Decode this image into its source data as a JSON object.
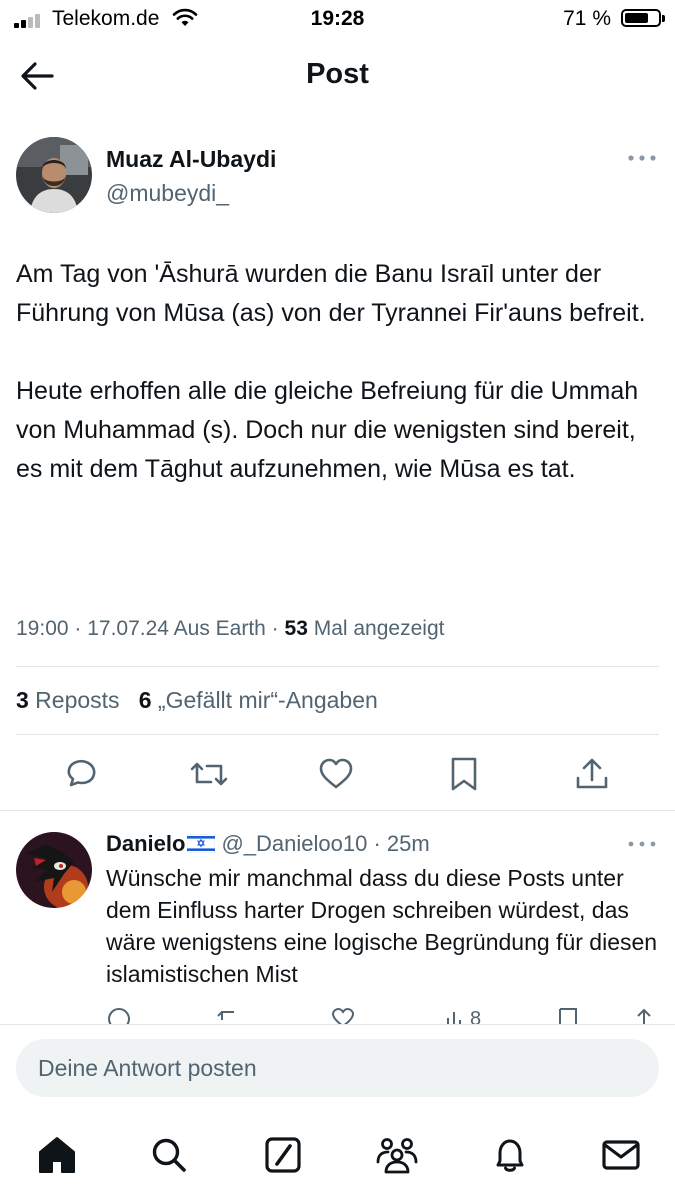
{
  "status_bar": {
    "carrier": "Telekom.de",
    "time": "19:28",
    "battery": "71 %",
    "battery_level": 0.71,
    "icons": [
      "signal-icon",
      "wifi-icon",
      "battery-icon"
    ]
  },
  "header": {
    "title": "Post",
    "back_icon": "back-arrow-icon"
  },
  "post": {
    "author_name": "Muaz Al-Ubaydi",
    "author_handle": "@mubeydi_",
    "paragraph1": "Am Tag von 'Āshurā wurden die Banu Israīl unter der Führung von Mūsa (as) von der Tyrannei Fir'auns befreit.",
    "paragraph2": "Heute erhoffen alle die gleiche Befreiung für die Ummah von Muhammad (s). Doch nur die wenigsten sind bereit, es mit dem Tāghut aufzunehmen, wie Mūsa es tat.",
    "meta_time": "19:00 · 17.07.24 Aus Earth · ",
    "views_count": "53",
    "views_label": " Mal angezeigt",
    "reposts_count": "3",
    "reposts_label": " Reposts",
    "likes_count": "6",
    "likes_label": " „Gefällt mir“-Angaben",
    "action_icons": [
      "reply-icon",
      "repost-icon",
      "like-icon",
      "bookmark-icon",
      "share-icon"
    ]
  },
  "reply": {
    "name": "Danielo",
    "handle": "@_Danieloo10",
    "time": "· 25m",
    "text": "Wünsche mir manchmal dass du diese Posts unter dem Einfluss harter Drogen schreiben würdest, das wäre wenigstens eine logische Begründung für diesen islamistischen Mist",
    "views": "8"
  },
  "compose": {
    "placeholder": "Deine Antwort posten"
  },
  "tab_bar": {
    "icons": [
      "home-icon",
      "search-icon",
      "compose-icon",
      "communities-icon",
      "notifications-icon",
      "messages-icon"
    ]
  },
  "colors": {
    "text": "#0f1419",
    "secondary": "#536471",
    "divider": "#e1e6ea",
    "input_bg": "#eff3f4"
  }
}
